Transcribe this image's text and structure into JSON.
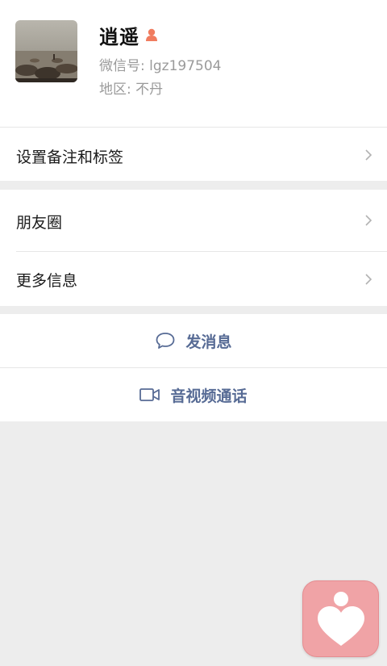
{
  "profile": {
    "name": "逍遥",
    "gender_icon": "gender-female-icon",
    "wechat_id_label": "微信号: lgz197504",
    "region_label": "地区: 不丹"
  },
  "cells": {
    "remark": "设置备注和标签",
    "moments": "朋友圈",
    "more_info": "更多信息"
  },
  "actions": {
    "send_message": "发消息",
    "video_call": "音视频通话"
  },
  "colors": {
    "accent": "#576b95",
    "background": "#ededed",
    "float_widget": "#f0a3a6"
  }
}
